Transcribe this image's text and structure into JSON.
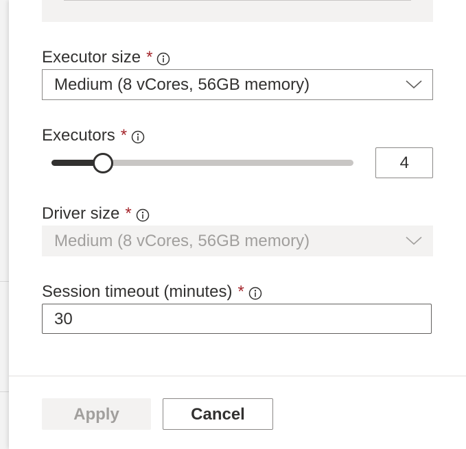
{
  "form": {
    "executor_size": {
      "label": "Executor size",
      "required_mark": "*",
      "value": "Medium (8 vCores, 56GB memory)"
    },
    "executors": {
      "label": "Executors",
      "required_mark": "*",
      "value": "4",
      "slider_fraction": 0.17
    },
    "driver_size": {
      "label": "Driver size",
      "required_mark": "*",
      "value": "Medium (8 vCores, 56GB memory)"
    },
    "session_timeout": {
      "label": "Session timeout (minutes)",
      "required_mark": "*",
      "value": "30"
    }
  },
  "footer": {
    "apply_label": "Apply",
    "cancel_label": "Cancel"
  },
  "colors": {
    "required": "#a4262c",
    "text": "#323130",
    "disabled_text": "#a19f9d",
    "disabled_bg": "#f3f2f1"
  },
  "icons": {
    "info": "info-icon",
    "dropdown": "chevron-down-icon"
  }
}
